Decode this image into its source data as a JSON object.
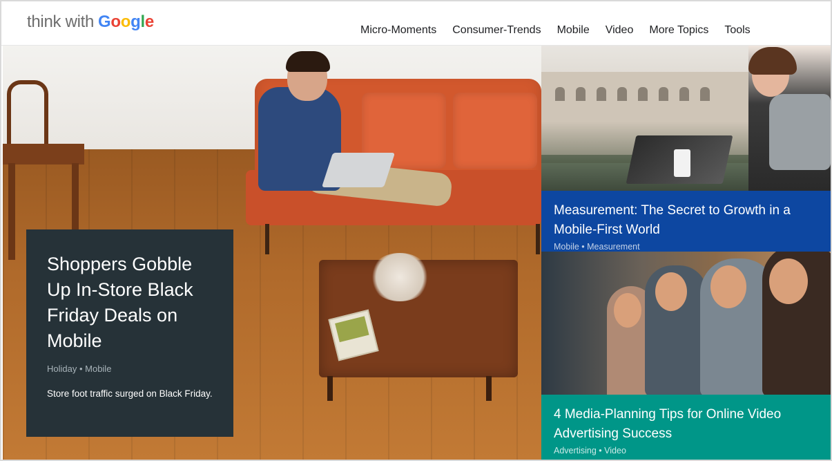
{
  "header": {
    "logo_think": "think with",
    "logo_google": [
      "G",
      "o",
      "o",
      "g",
      "l",
      "e"
    ]
  },
  "nav": {
    "items": [
      {
        "label": "Micro-Moments"
      },
      {
        "label": "Consumer-Trends"
      },
      {
        "label": "Mobile"
      },
      {
        "label": "Video"
      },
      {
        "label": "More Topics"
      },
      {
        "label": "Tools"
      }
    ]
  },
  "hero": {
    "title": "Shoppers Gobble Up In-Store Black Friday Deals on Mobile",
    "tags": "Holiday • Mobile",
    "description": "Store foot traffic surged on Black Friday.",
    "card_color": "#263238"
  },
  "articles": [
    {
      "title": "Measurement: The Secret to Growth in a Mobile-First World",
      "tags": "Mobile • Measurement",
      "color": "#0d47a1"
    },
    {
      "title": "4 Media-Planning Tips for Online Video Advertising Success",
      "tags": "Advertising • Video",
      "color": "#009688"
    }
  ],
  "colors": {
    "google_blue": "#4285f4",
    "google_red": "#ea4335",
    "google_yellow": "#fbbc05",
    "google_green": "#34a853"
  }
}
